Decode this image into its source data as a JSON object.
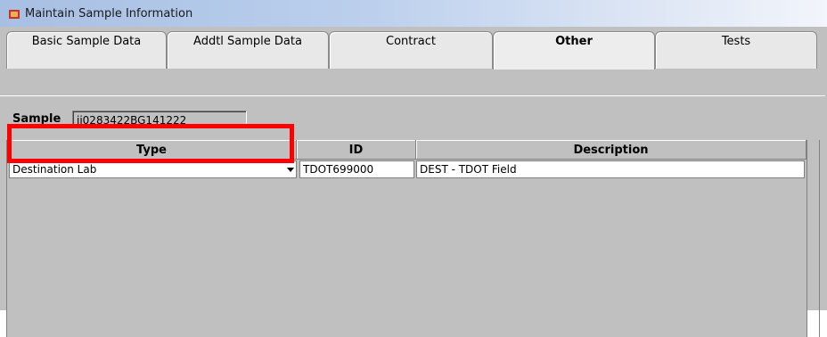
{
  "window": {
    "title": "Maintain Sample Information"
  },
  "tabs": [
    {
      "label": "Basic Sample Data"
    },
    {
      "label": "Addtl Sample Data"
    },
    {
      "label": "Contract"
    },
    {
      "label": "Other",
      "active": true
    },
    {
      "label": "Tests"
    }
  ],
  "sample": {
    "label": "Sample",
    "value": "jj0283422BG141222"
  },
  "table": {
    "columns": [
      "Type",
      "ID",
      "Description"
    ],
    "rows": [
      {
        "type": "Destination Lab",
        "id": "TDOT699000",
        "description": "DEST - TDOT Field"
      }
    ]
  },
  "highlight": {
    "color": "#ff0000"
  }
}
